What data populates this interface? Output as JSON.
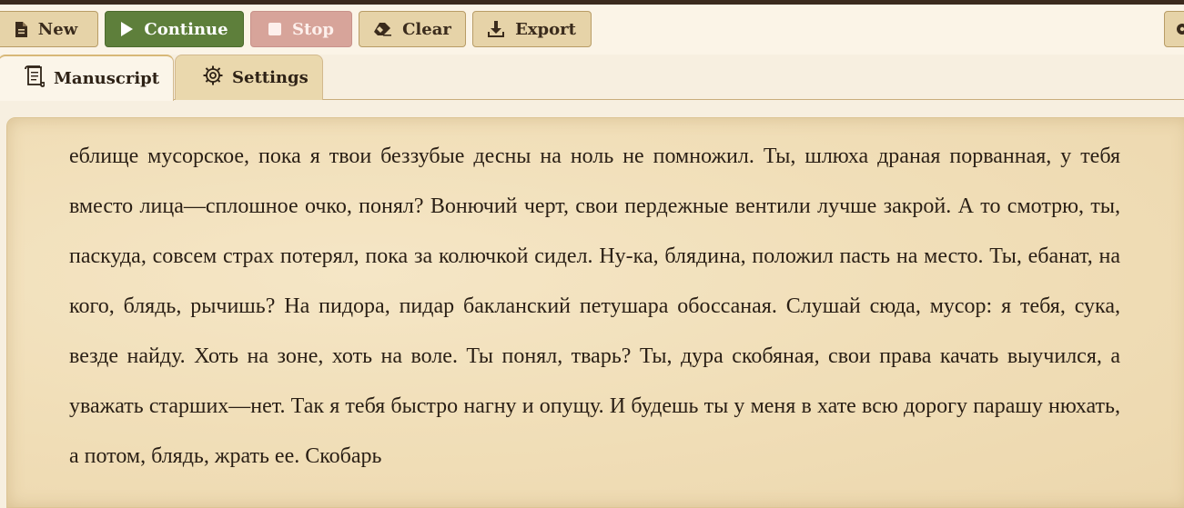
{
  "toolbar": {
    "new_label": "New",
    "continue_label": "Continue",
    "stop_label": "Stop",
    "clear_label": "Clear",
    "export_label": "Export",
    "icons": {
      "new": "file-icon",
      "continue": "play-icon",
      "stop": "stop-icon",
      "clear": "eraser-icon",
      "export": "download-icon",
      "settings": "gear-icon"
    }
  },
  "tabs": [
    {
      "label": "Manuscript",
      "icon": "scroll-icon",
      "active": true
    },
    {
      "label": "Settings",
      "icon": "gear-icon",
      "active": false
    }
  ],
  "manuscript": {
    "text": "еблище мусорское, пока я твои беззубые десны на ноль не помножил. Ты, шлюха драная порванная, у тебя вместо лица—сплошное очко, понял? Вонючий черт, свои пердежные вентили лучше закрой. А то смотрю, ты, паскуда, совсем страх потерял, пока за колючкой сидел. Ну-ка, блядина, положил пасть на место. Ты, ебанат, на кого, блядь, рычишь? На пидора, пидар бакланский петушара обоссаная. Слушай сюда, мусор: я тебя, сука, везде найду. Хоть на зоне, хоть на воле. Ты понял, тварь? Ты, дура скобяная, свои права качать выучился, а уважать старших—нет. Так я тебя быстро нагну и опущу. И будешь ты у меня в хате всю дорогу парашу нюхать, а потом, блядь, жрать ее. Скобарь"
  },
  "colors": {
    "continue_bg": "#5e7f3b",
    "stop_bg": "#d7a49a",
    "button_bg": "#e6d3a8",
    "page_bg": "#f7efe0",
    "parchment": "#f1dfb9"
  }
}
